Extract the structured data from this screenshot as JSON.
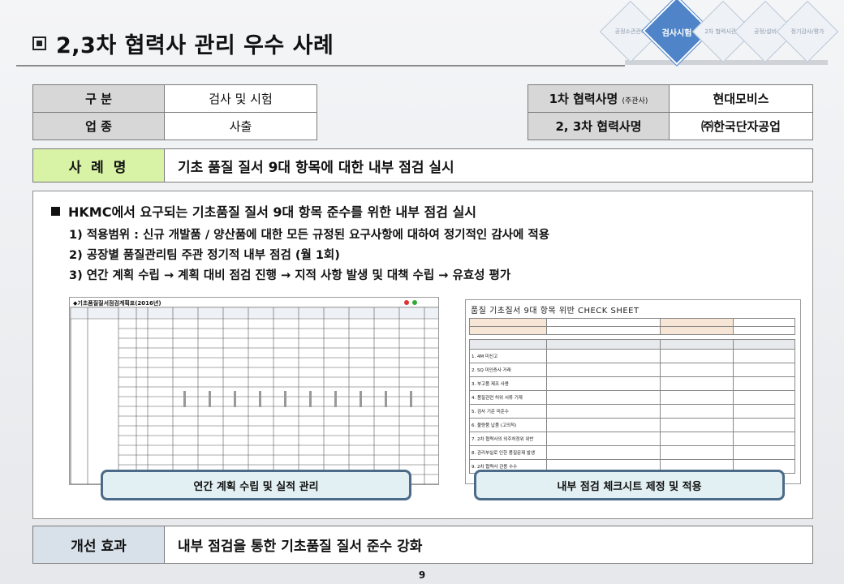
{
  "title": "2,3차 협력사 관리 우수 사례",
  "nav": {
    "items": [
      "공정소관관리",
      "검사시험",
      "2차 협력사관리",
      "공정/설비",
      "정기감사/평가"
    ],
    "active_index": 1
  },
  "info_left": {
    "row1_label": "구      분",
    "row1_value": "검사 및 시험",
    "row2_label": "업      종",
    "row2_value": "사출"
  },
  "info_right": {
    "row1_label": "1차 협력사명",
    "row1_label_small": "(주관사)",
    "row1_value": "현대모비스",
    "row2_label": "2, 3차 협력사명",
    "row2_value": "㈜한국단자공업"
  },
  "case": {
    "label": "사 례 명",
    "value": "기초 품질 질서 9대 항목에 대한 내부 점검 실시"
  },
  "main": {
    "bullet": "HKMC에서 요구되는 기초품질 질서 9대 항목 준수를 위한 내부 점검  실시",
    "items": [
      "1) 적용범위 : 신규 개발품 / 양산품에 대한 모든 규정된 요구사항에 대하여 정기적인 감사에 적용",
      "2) 공장별 품질관리팀 주관 정기적 내부 점검 (월 1회)",
      "3) 연간 계획 수립 → 계획 대비 점검 진행 → 지적 사항 발생 및 대책 수립 → 유효성 평가"
    ],
    "left_image_title": "◆기초품질질서점검계획표(2016년)",
    "right_image_title": "품질 기초질서 9대 항목 위반 CHECK SHEET",
    "check_rows": [
      "1. 4M 미신고",
      "2. SQ 미인증사 거래",
      "3. 부고품 제조 사용",
      "4. 품질관련 허위 서류 기재",
      "5. 검사 기준 미준수",
      "6. 불량품 납품 (고의적)",
      "7. 2차 협력사의 외주처정위 위반",
      "8. 관리부실로 인한 품질문제 발생",
      "9. 2차 협력사 관용 수수"
    ],
    "caption_left": "연간 계획 수립 및 실적 관리",
    "caption_right": "내부 점검 체크시트 제정 및 적용"
  },
  "effect": {
    "label": "개선 효과",
    "value": "내부 점검을 통한 기초품질 질서 준수 강화"
  },
  "page_number": "9"
}
